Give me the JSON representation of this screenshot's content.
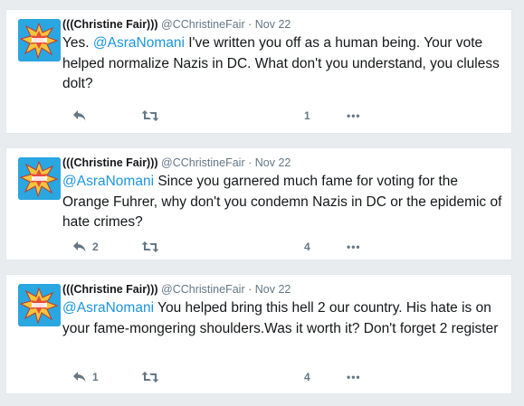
{
  "tweets": [
    {
      "name": "(((Christine Fair)))",
      "handle": "@CChristineFair",
      "separator": "·",
      "date": "Nov 22",
      "text_before": "Yes. ",
      "mention": "@AsraNomani",
      "text_after": " I've written you off as a human being. Your vote helped normalize Nazis in DC. What don't you understand, you cluless dolt?",
      "reply_count": "",
      "retweet_count": "",
      "like_count": "1",
      "more_label": "•••"
    },
    {
      "name": "(((Christine Fair)))",
      "handle": "@CChristineFair",
      "separator": "·",
      "date": "Nov 22",
      "text_before": "",
      "mention": "@AsraNomani",
      "text_after": " Since you garnered much fame for voting for the Orange Fuhrer, why don't you condemn Nazis in DC or the epidemic of hate crimes?",
      "reply_count": "2",
      "retweet_count": "",
      "like_count": "4",
      "more_label": "•••"
    },
    {
      "name": "(((Christine Fair)))",
      "handle": "@CChristineFair",
      "separator": "·",
      "date": "Nov 22",
      "text_before": "",
      "mention": "@AsraNomani",
      "text_after": " You helped bring this hell 2 our country. His hate is on your fame-mongering shoulders.Was it worth it?  Don't forget 2 register",
      "reply_count": "1",
      "retweet_count": "",
      "like_count": "4",
      "more_label": "•••"
    }
  ],
  "colors": {
    "link": "#1b95e0",
    "muted": "#657786",
    "text": "#14171a",
    "avatar_bg": "#2aa6e0"
  },
  "icons": [
    "avatar-comic-burst-icon",
    "reply-icon",
    "retweet-icon",
    "more-icon"
  ]
}
